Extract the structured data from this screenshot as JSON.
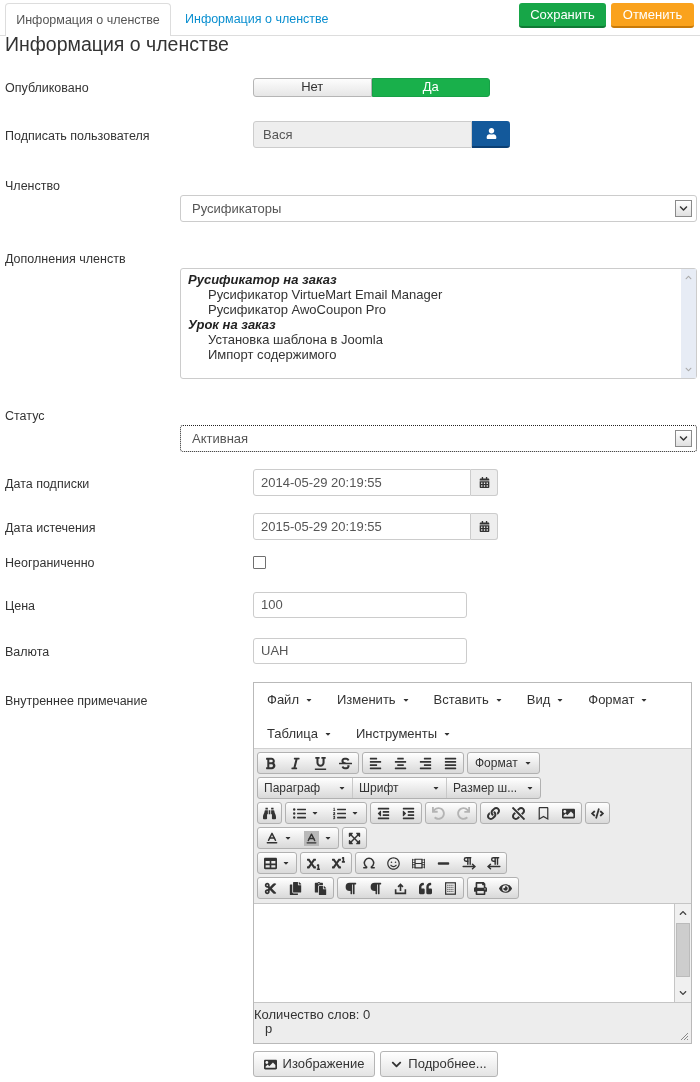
{
  "tabs": [
    {
      "label": "Информация о членстве",
      "selected": true
    },
    {
      "label": "Информация о членстве",
      "selected": false
    }
  ],
  "actions": [
    {
      "kind": "save",
      "label": "Сохранить"
    },
    {
      "kind": "cancel",
      "label": "Отменить"
    }
  ],
  "heading": "Информация о членстве",
  "fields": [
    {
      "kind": "toggle",
      "label": "Опубликовано",
      "options": [
        {
          "label": "Нет",
          "selected": false
        },
        {
          "label": "Да",
          "selected": true
        }
      ]
    },
    {
      "kind": "user",
      "label": "Подписать пользователя",
      "value": "Вася"
    },
    {
      "kind": "select",
      "label": "Членство",
      "value": "Русификаторы",
      "focused": false
    },
    {
      "kind": "listbox",
      "label": "Дополнения членств",
      "groups": [
        {
          "label": "Русификатор на заказ",
          "children": [
            {
              "label": "Русификатор VirtueMart Email Manager",
              "selected": false
            },
            {
              "label": "Русификатор AwoCoupon Pro",
              "selected": false
            }
          ]
        },
        {
          "label": "Урок на заказ",
          "children": [
            {
              "label": "Установка шаблона в Joomla",
              "selected": false
            },
            {
              "label": "Импорт содержимого",
              "selected": false
            }
          ]
        }
      ]
    },
    {
      "kind": "select",
      "label": "Статус",
      "value": "Активная",
      "focused": true
    },
    {
      "kind": "date",
      "label": "Дата подписки",
      "value": "2014-05-29 20:19:55"
    },
    {
      "kind": "date",
      "label": "Дата истечения",
      "value": "2015-05-29 20:19:55"
    },
    {
      "kind": "checkbox",
      "label": "Неограниченно",
      "checked": false
    },
    {
      "kind": "text",
      "label": "Цена",
      "value": "100"
    },
    {
      "kind": "text",
      "label": "Валюта",
      "value": "UAH"
    },
    {
      "kind": "editor",
      "label": "Внутреннее примечание",
      "menus": [
        "Файл",
        "Изменить",
        "Вставить",
        "Вид",
        "Формат",
        "Таблица",
        "Инструменты"
      ],
      "toolbar": {
        "format": "Формат",
        "block_format": "Параграф",
        "font": "Шрифт",
        "font_size": "Размер ш...",
        "undo": {
          "disabled": true
        },
        "redo": {
          "disabled": true
        }
      },
      "word_count": "Количество слов: 0",
      "path": "p",
      "buttons": [
        {
          "kind": "image",
          "label": "Изображение"
        },
        {
          "kind": "more",
          "label": "Подробнее..."
        }
      ]
    }
  ]
}
